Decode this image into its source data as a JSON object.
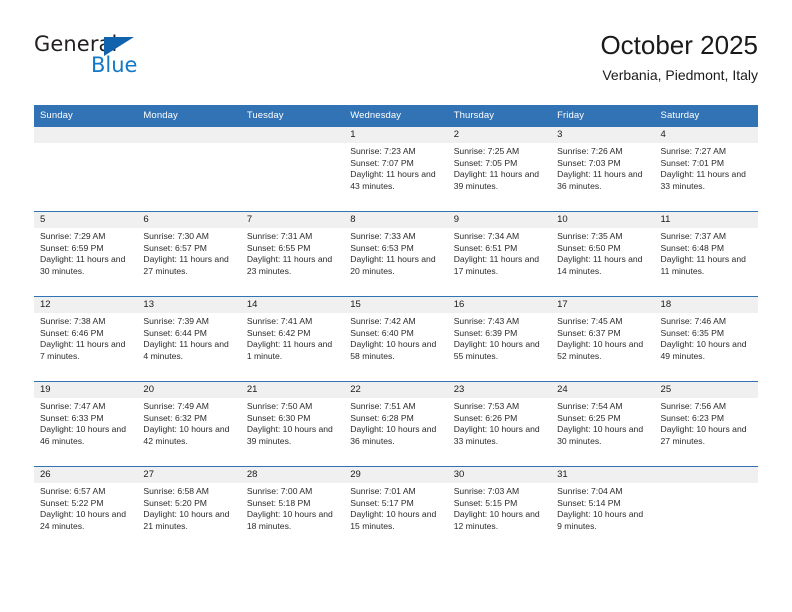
{
  "brand": {
    "word_one": "General",
    "word_two": "Blue",
    "triangle_icon": "blue-triangle-icon",
    "accent_color": "#1378c8"
  },
  "header": {
    "title": "October 2025",
    "subtitle": "Verbania, Piedmont, Italy"
  },
  "calendar": {
    "header_color": "#3273b5",
    "daynum_band_color": "#f0f0f0",
    "weekdays": [
      "Sunday",
      "Monday",
      "Tuesday",
      "Wednesday",
      "Thursday",
      "Friday",
      "Saturday"
    ],
    "weeks": [
      [
        {
          "day": "",
          "empty": true
        },
        {
          "day": "",
          "empty": true
        },
        {
          "day": "",
          "empty": true
        },
        {
          "day": "1",
          "sunrise": "Sunrise: 7:23 AM",
          "sunset": "Sunset: 7:07 PM",
          "daylight": "Daylight: 11 hours and 43 minutes."
        },
        {
          "day": "2",
          "sunrise": "Sunrise: 7:25 AM",
          "sunset": "Sunset: 7:05 PM",
          "daylight": "Daylight: 11 hours and 39 minutes."
        },
        {
          "day": "3",
          "sunrise": "Sunrise: 7:26 AM",
          "sunset": "Sunset: 7:03 PM",
          "daylight": "Daylight: 11 hours and 36 minutes."
        },
        {
          "day": "4",
          "sunrise": "Sunrise: 7:27 AM",
          "sunset": "Sunset: 7:01 PM",
          "daylight": "Daylight: 11 hours and 33 minutes."
        }
      ],
      [
        {
          "day": "5",
          "sunrise": "Sunrise: 7:29 AM",
          "sunset": "Sunset: 6:59 PM",
          "daylight": "Daylight: 11 hours and 30 minutes."
        },
        {
          "day": "6",
          "sunrise": "Sunrise: 7:30 AM",
          "sunset": "Sunset: 6:57 PM",
          "daylight": "Daylight: 11 hours and 27 minutes."
        },
        {
          "day": "7",
          "sunrise": "Sunrise: 7:31 AM",
          "sunset": "Sunset: 6:55 PM",
          "daylight": "Daylight: 11 hours and 23 minutes."
        },
        {
          "day": "8",
          "sunrise": "Sunrise: 7:33 AM",
          "sunset": "Sunset: 6:53 PM",
          "daylight": "Daylight: 11 hours and 20 minutes."
        },
        {
          "day": "9",
          "sunrise": "Sunrise: 7:34 AM",
          "sunset": "Sunset: 6:51 PM",
          "daylight": "Daylight: 11 hours and 17 minutes."
        },
        {
          "day": "10",
          "sunrise": "Sunrise: 7:35 AM",
          "sunset": "Sunset: 6:50 PM",
          "daylight": "Daylight: 11 hours and 14 minutes."
        },
        {
          "day": "11",
          "sunrise": "Sunrise: 7:37 AM",
          "sunset": "Sunset: 6:48 PM",
          "daylight": "Daylight: 11 hours and 11 minutes."
        }
      ],
      [
        {
          "day": "12",
          "sunrise": "Sunrise: 7:38 AM",
          "sunset": "Sunset: 6:46 PM",
          "daylight": "Daylight: 11 hours and 7 minutes."
        },
        {
          "day": "13",
          "sunrise": "Sunrise: 7:39 AM",
          "sunset": "Sunset: 6:44 PM",
          "daylight": "Daylight: 11 hours and 4 minutes."
        },
        {
          "day": "14",
          "sunrise": "Sunrise: 7:41 AM",
          "sunset": "Sunset: 6:42 PM",
          "daylight": "Daylight: 11 hours and 1 minute."
        },
        {
          "day": "15",
          "sunrise": "Sunrise: 7:42 AM",
          "sunset": "Sunset: 6:40 PM",
          "daylight": "Daylight: 10 hours and 58 minutes."
        },
        {
          "day": "16",
          "sunrise": "Sunrise: 7:43 AM",
          "sunset": "Sunset: 6:39 PM",
          "daylight": "Daylight: 10 hours and 55 minutes."
        },
        {
          "day": "17",
          "sunrise": "Sunrise: 7:45 AM",
          "sunset": "Sunset: 6:37 PM",
          "daylight": "Daylight: 10 hours and 52 minutes."
        },
        {
          "day": "18",
          "sunrise": "Sunrise: 7:46 AM",
          "sunset": "Sunset: 6:35 PM",
          "daylight": "Daylight: 10 hours and 49 minutes."
        }
      ],
      [
        {
          "day": "19",
          "sunrise": "Sunrise: 7:47 AM",
          "sunset": "Sunset: 6:33 PM",
          "daylight": "Daylight: 10 hours and 46 minutes."
        },
        {
          "day": "20",
          "sunrise": "Sunrise: 7:49 AM",
          "sunset": "Sunset: 6:32 PM",
          "daylight": "Daylight: 10 hours and 42 minutes."
        },
        {
          "day": "21",
          "sunrise": "Sunrise: 7:50 AM",
          "sunset": "Sunset: 6:30 PM",
          "daylight": "Daylight: 10 hours and 39 minutes."
        },
        {
          "day": "22",
          "sunrise": "Sunrise: 7:51 AM",
          "sunset": "Sunset: 6:28 PM",
          "daylight": "Daylight: 10 hours and 36 minutes."
        },
        {
          "day": "23",
          "sunrise": "Sunrise: 7:53 AM",
          "sunset": "Sunset: 6:26 PM",
          "daylight": "Daylight: 10 hours and 33 minutes."
        },
        {
          "day": "24",
          "sunrise": "Sunrise: 7:54 AM",
          "sunset": "Sunset: 6:25 PM",
          "daylight": "Daylight: 10 hours and 30 minutes."
        },
        {
          "day": "25",
          "sunrise": "Sunrise: 7:56 AM",
          "sunset": "Sunset: 6:23 PM",
          "daylight": "Daylight: 10 hours and 27 minutes."
        }
      ],
      [
        {
          "day": "26",
          "sunrise": "Sunrise: 6:57 AM",
          "sunset": "Sunset: 5:22 PM",
          "daylight": "Daylight: 10 hours and 24 minutes."
        },
        {
          "day": "27",
          "sunrise": "Sunrise: 6:58 AM",
          "sunset": "Sunset: 5:20 PM",
          "daylight": "Daylight: 10 hours and 21 minutes."
        },
        {
          "day": "28",
          "sunrise": "Sunrise: 7:00 AM",
          "sunset": "Sunset: 5:18 PM",
          "daylight": "Daylight: 10 hours and 18 minutes."
        },
        {
          "day": "29",
          "sunrise": "Sunrise: 7:01 AM",
          "sunset": "Sunset: 5:17 PM",
          "daylight": "Daylight: 10 hours and 15 minutes."
        },
        {
          "day": "30",
          "sunrise": "Sunrise: 7:03 AM",
          "sunset": "Sunset: 5:15 PM",
          "daylight": "Daylight: 10 hours and 12 minutes."
        },
        {
          "day": "31",
          "sunrise": "Sunrise: 7:04 AM",
          "sunset": "Sunset: 5:14 PM",
          "daylight": "Daylight: 10 hours and 9 minutes."
        },
        {
          "day": "",
          "empty": true
        }
      ]
    ]
  }
}
